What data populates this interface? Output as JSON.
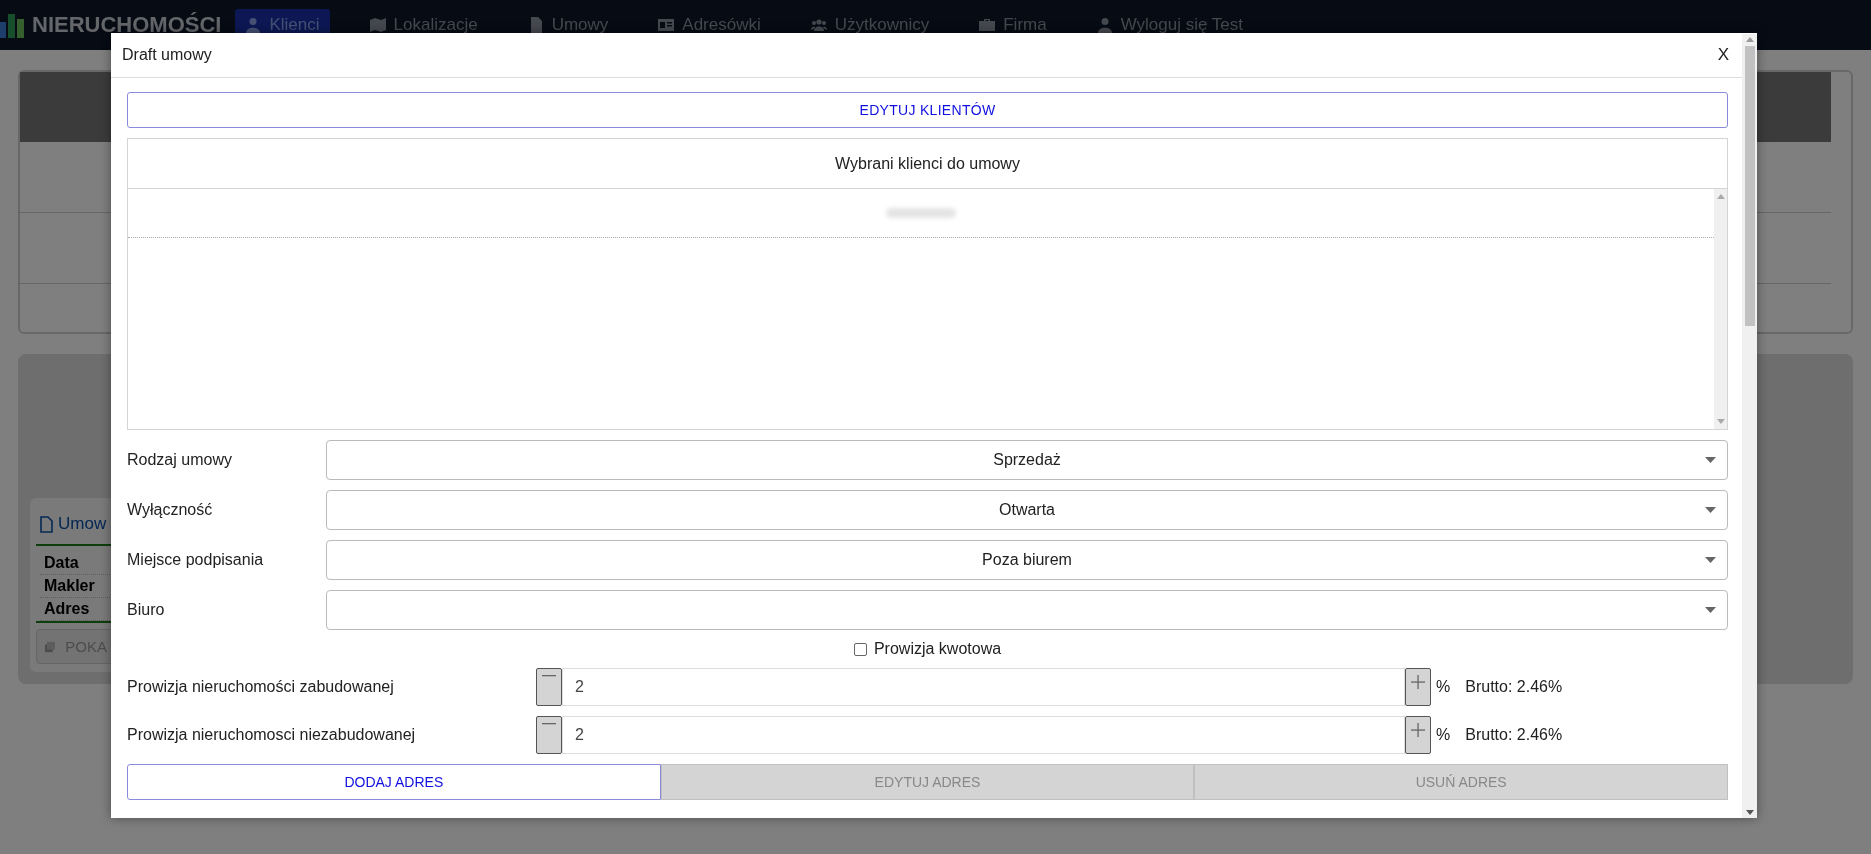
{
  "navbar": {
    "logo": "NIERUCHOMOŚCI",
    "items": [
      {
        "label": "Klienci",
        "selected": true
      },
      {
        "label": "Lokalizacje",
        "selected": false
      },
      {
        "label": "Umowy",
        "selected": false
      },
      {
        "label": "Adresówki",
        "selected": false
      },
      {
        "label": "Użytkownicy",
        "selected": false
      },
      {
        "label": "Firma",
        "selected": false
      },
      {
        "label": "Wyloguj się Test",
        "selected": false
      }
    ]
  },
  "background": {
    "card_title": "Umow",
    "fields": [
      "Data",
      "Makler",
      "Adres"
    ],
    "button": "POKA"
  },
  "dialog": {
    "title": "Draft umowy",
    "close": "X",
    "edit_clients_button": "EDYTUJ KLIENTÓW",
    "clients_header": "Wybrani klienci do umowy",
    "fields": [
      {
        "label": "Rodzaj umowy",
        "value": "Sprzedaż"
      },
      {
        "label": "Wyłączność",
        "value": "Otwarta"
      },
      {
        "label": "Miejsce podpisania",
        "value": "Poza biurem"
      },
      {
        "label": "Biuro"
      }
    ],
    "fixed_commission": {
      "label": "Prowizja kwotowa",
      "checked": false
    },
    "commissions": [
      {
        "label": "Prowizja nieruchomości zabudowanej",
        "value": "2",
        "unit": "%",
        "gross": "Brutto: 2.46%"
      },
      {
        "label": "Prowizja nieruchomosci niezabudowanej",
        "value": "2",
        "unit": "%",
        "gross": "Brutto: 2.46%"
      }
    ],
    "address_buttons": [
      {
        "label": "DODAJ ADRES",
        "disabled": false
      },
      {
        "label": "EDYTUJ ADRES",
        "disabled": true
      },
      {
        "label": "USUŃ ADRES",
        "disabled": true
      }
    ]
  }
}
